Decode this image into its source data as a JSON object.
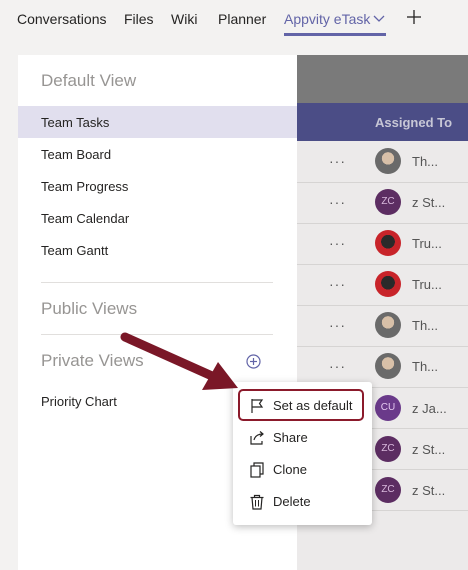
{
  "tabs": [
    {
      "label": "Conversations"
    },
    {
      "label": "Files"
    },
    {
      "label": "Wiki"
    },
    {
      "label": "Planner"
    },
    {
      "label": "Appvity eTask"
    }
  ],
  "table": {
    "assigned_header": "Assigned To",
    "rows": [
      {
        "assignee": "Th...",
        "initials": ""
      },
      {
        "assignee": "z St...",
        "initials": "ZC"
      },
      {
        "assignee": "Tru...",
        "initials": ""
      },
      {
        "assignee": "Tru...",
        "initials": ""
      },
      {
        "assignee": "Th...",
        "initials": ""
      },
      {
        "assignee": "Th...",
        "initials": ""
      },
      {
        "assignee": "z Ja...",
        "initials": "CU"
      },
      {
        "assignee": "z St...",
        "initials": "ZC"
      },
      {
        "assignee": "z St...",
        "initials": "ZC"
      }
    ],
    "row_menu": "···"
  },
  "panel": {
    "default_view_title": "Default View",
    "default_views": [
      "Team Tasks",
      "Team Board",
      "Team Progress",
      "Team Calendar",
      "Team Gantt"
    ],
    "public_views_title": "Public Views",
    "private_views_title": "Private Views",
    "private_views": [
      "Priority Chart"
    ]
  },
  "context_menu": {
    "items": [
      {
        "label": "Set as default",
        "icon": "flag-icon"
      },
      {
        "label": "Share",
        "icon": "share-icon"
      },
      {
        "label": "Clone",
        "icon": "clone-icon"
      },
      {
        "label": "Delete",
        "icon": "trash-icon"
      }
    ]
  },
  "colors": {
    "accent": "#6264a7",
    "annotation": "#8b1a2b"
  }
}
